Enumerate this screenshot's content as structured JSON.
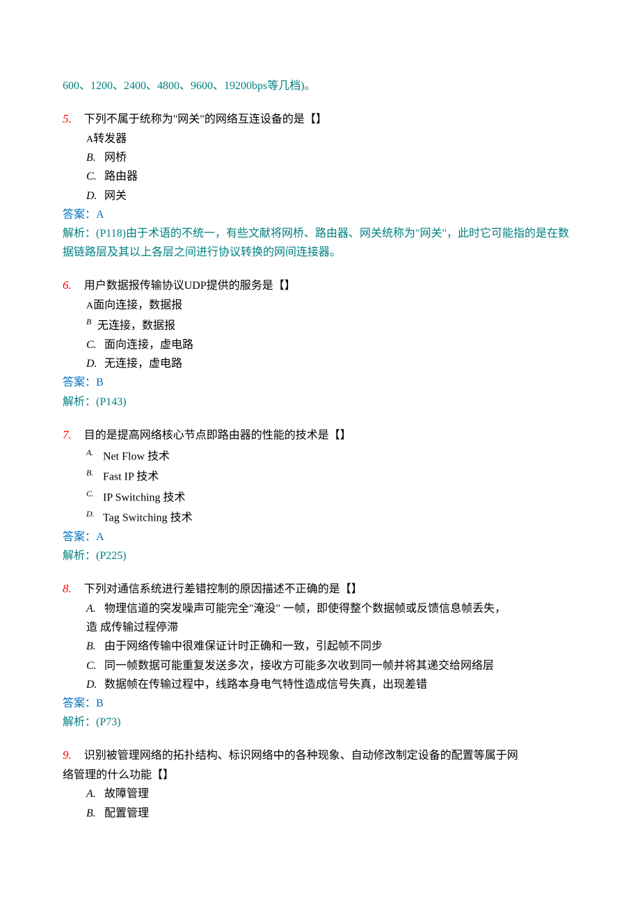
{
  "intro_tail": "600、1200、2400、4800、9600、19200bps等几档)。",
  "q5": {
    "num": "5.",
    "stem": "下列不属于统称为\"网关\"的网络互连设备的是【】",
    "optA_label": "A",
    "optA_text": "转发器",
    "optB_label": "B.",
    "optB_text": "网桥",
    "optC_label": "C.",
    "optC_text": "路由器",
    "optD_label": "D.",
    "optD_text": "网关",
    "answer": "答案：A",
    "analysis": "解析：(P118)由于术语的不统一，有些文献将网桥、路由器、网关统称为\"网关\"，此时它可能指的是在数据链路层及其以上各层之间进行协议转换的网间连接器。"
  },
  "q6": {
    "num": "6.",
    "stem": "用户数据报传输协议UDP提供的服务是【】",
    "optA_label": "A",
    "optA_text": "面向连接，数据报",
    "optB_label": "B",
    "optB_text": "无连接，数据报",
    "optC_label": "C.",
    "optC_text": "面向连接，虚电路",
    "optD_label": "D.",
    "optD_text": "无连接，虚电路",
    "answer": "答案：B",
    "analysis": "解析：(P143)"
  },
  "q7": {
    "num": "7.",
    "stem": "目的是提高网络核心节点即路由器的性能的技术是【】",
    "optA_label": "A.",
    "optA_text": "Net Flow 技术",
    "optB_label": "B.",
    "optB_text": "Fast IP 技术",
    "optC_label": "C.",
    "optC_text": "IP Switching 技术",
    "optD_label": "D.",
    "optD_text": "Tag Switching 技术",
    "answer": "答案：A",
    "analysis": "解析：(P225)"
  },
  "q8": {
    "num": "8.",
    "stem": "下列对通信系统进行差错控制的原因描述不正确的是【】",
    "optA_label": "A.",
    "optA_text": "物理信道的突发噪声可能完全\"淹没\" 一帧，即使得整个数据帧或反馈信息帧丢失，",
    "optA_cont": "造 成传输过程停滞",
    "optB_label": "B.",
    "optB_text": "由于网络传输中很难保证计时正确和一致，引起帧不同步",
    "optC_label": "C.",
    "optC_text": "同一帧数据可能重复发送多次，接收方可能多次收到同一帧并将其递交给网络层",
    "optD_label": "D.",
    "optD_text": "数据帧在传输过程中，线路本身电气特性造成信号失真，出现差错",
    "answer": "答案：B",
    "analysis": "解析：(P73)"
  },
  "q9": {
    "num": "9.",
    "stem1": "识别被管理网络的拓扑结构、标识网络中的各种现象、自动修改制定设备的配置等属于网",
    "stem2": "络管理的什么功能【】",
    "optA_label": "A.",
    "optA_text": "故障管理",
    "optB_label": "B.",
    "optB_text": "配置管理"
  }
}
